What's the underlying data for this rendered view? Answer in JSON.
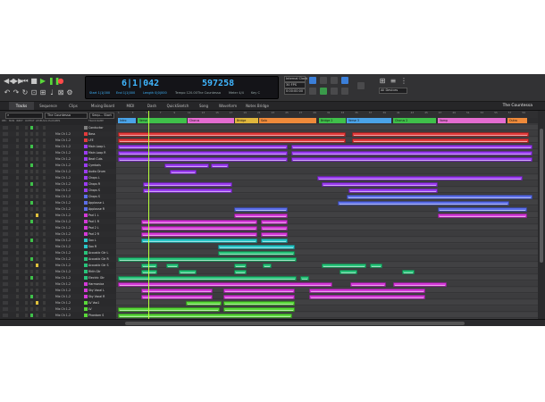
{
  "control_bar": {
    "counter_bars": "6|1|042",
    "counter_samples": "597258",
    "counter_small": [
      "Start  1|1|000",
      "End  1|1|000",
      "Length  0|0|000"
    ],
    "sub_labels": [
      "Tempo  120.00",
      "Meter  4/4",
      "Key  C"
    ],
    "song_name": "The Countessa",
    "right_panel": {
      "sync": "Internal Clock",
      "fps": "30 FPS",
      "offset": "0:00:00:00",
      "wave_label": "All Devices"
    }
  },
  "tabs": [
    {
      "label": "Tracks",
      "active": true
    },
    {
      "label": "Sequence",
      "active": false
    },
    {
      "label": "Clips",
      "active": false
    },
    {
      "label": "Mixing Board",
      "active": false
    },
    {
      "label": "MIDI",
      "active": false
    },
    {
      "label": "Dash",
      "active": false
    },
    {
      "label": "QuickSketch",
      "active": false
    },
    {
      "label": "Song",
      "active": false
    },
    {
      "label": "Waveform",
      "active": false
    },
    {
      "label": "Notes Bridge",
      "active": false
    }
  ],
  "window_title": "The Countessa",
  "track_toolbar": {
    "sequence": "The Countessa",
    "selector": "Sequ... Start"
  },
  "column_headers": [
    "REC",
    "MON",
    "INPUT",
    "OUTPUT",
    "LEVEL",
    "SOL",
    "PLAY",
    "AMPS",
    "TRACK NAME"
  ],
  "tracks": [
    {
      "io": "",
      "name": "Conductor",
      "color": "#7f7f7f"
    },
    {
      "io": "Mix Ch 1-2",
      "name": "Bass",
      "color": "#e23b3b"
    },
    {
      "io": "Mix Ch 1-2",
      "name": "LFE",
      "color": "#e23b3b"
    },
    {
      "io": "Mix Ch 1-2",
      "name": "Main Loop L",
      "color": "#9a3cf0"
    },
    {
      "io": "Mix Ch 1-2",
      "name": "Main Loop R",
      "color": "#9a3cf0"
    },
    {
      "io": "Mix Ch 1-2",
      "name": "Beat Cuts",
      "color": "#9a3cf0"
    },
    {
      "io": "Mix Ch 1-2",
      "name": "Cymbals",
      "color": "#9a3cf0"
    },
    {
      "io": "Mix Ch 1-2",
      "name": "Audio Drum",
      "color": "#9a3cf0"
    },
    {
      "io": "Mix Ch 1-2",
      "name": "Chops L",
      "color": "#9a3cf0"
    },
    {
      "io": "Mix Ch 1-2",
      "name": "Chops R",
      "color": "#9a3cf0"
    },
    {
      "io": "Mix Ch 1-2",
      "name": "Chops  S",
      "color": "#9a3cf0"
    },
    {
      "io": "Mix Ch 1-2",
      "name": "Chops  S",
      "color": "#5b6ee8"
    },
    {
      "io": "Mix Ch 1-2",
      "name": "Applause L",
      "color": "#5b6ee8"
    },
    {
      "io": "Mix Ch 1-2",
      "name": "Applause R",
      "color": "#5b6ee8"
    },
    {
      "io": "Mix Ch 1-2",
      "name": "Pad 1 L",
      "color": "#d43ad8"
    },
    {
      "io": "Mix Ch 1-2",
      "name": "Pad 1 R",
      "color": "#d43ad8"
    },
    {
      "io": "Mix Ch 1-2",
      "name": "Pad 2 L",
      "color": "#d43ad8"
    },
    {
      "io": "Mix Ch 1-2",
      "name": "Pad 2 R",
      "color": "#d43ad8"
    },
    {
      "io": "Mix Ch 1-2",
      "name": "Sax L",
      "color": "#2ac6c8"
    },
    {
      "io": "Mix Ch 1-2",
      "name": "Sax R",
      "color": "#2ac6c8"
    },
    {
      "io": "Mix Ch 1-2",
      "name": "Acoustic Gtr L",
      "color": "#29c37a"
    },
    {
      "io": "Mix Ch 1-2",
      "name": "Acoustic Gtr R",
      "color": "#29c37a"
    },
    {
      "io": "Mix Ch 1-2",
      "name": "Acoustic Gtr S",
      "color": "#29c37a"
    },
    {
      "io": "Mix Ch 1-2",
      "name": "Rhth Gtr",
      "color": "#29c37a"
    },
    {
      "io": "Mix Ch 1-2",
      "name": "Electric Gtr",
      "color": "#29c37a"
    },
    {
      "io": "Mix Ch 1-2",
      "name": "Harmonica",
      "color": "#d43ad8"
    },
    {
      "io": "Mix Ch 1-2",
      "name": "Sky Vocal L",
      "color": "#d43ad8"
    },
    {
      "io": "Mix Ch 1-2",
      "name": "Sky Vocal R",
      "color": "#d43ad8"
    },
    {
      "io": "Mix Ch 1-2",
      "name": "LV Vox1",
      "color": "#5ad83a"
    },
    {
      "io": "Mix Ch 1-2",
      "name": "LV",
      "color": "#5ad83a"
    },
    {
      "io": "Mix Ch 1-2",
      "name": "Phantom S",
      "color": "#5ad83a"
    }
  ],
  "ruler_ticks": [
    "1",
    "3",
    "5",
    "7",
    "9",
    "11",
    "13",
    "15",
    "17",
    "19",
    "21",
    "23",
    "25",
    "27",
    "29",
    "31",
    "33",
    "35",
    "37",
    "39",
    "41",
    "43",
    "45",
    "47",
    "49",
    "51",
    "53",
    "55",
    "57",
    "59"
  ],
  "markers": [
    {
      "label": "Intro",
      "color": "#4aa3e8"
    },
    {
      "label": "Verse",
      "color": "#3fc04a"
    },
    {
      "label": "Chorus",
      "color": "#e46cd0"
    },
    {
      "label": "Bridge",
      "color": "#e0b63c"
    },
    {
      "label": "Solo",
      "color": "#ef8a3a"
    },
    {
      "label": "Bridge 2",
      "color": "#3fc04a"
    },
    {
      "label": "Verse 3",
      "color": "#4aa3e8"
    },
    {
      "label": "Chorus 2",
      "color": "#3fc04a"
    },
    {
      "label": "Vamp",
      "color": "#e46cd0"
    },
    {
      "label": "Outro",
      "color": "#ef8a3a"
    }
  ],
  "colors": {
    "accent": "#3fb6ff",
    "playhead": "#b6ff3a",
    "background": "#2b2b2d"
  }
}
